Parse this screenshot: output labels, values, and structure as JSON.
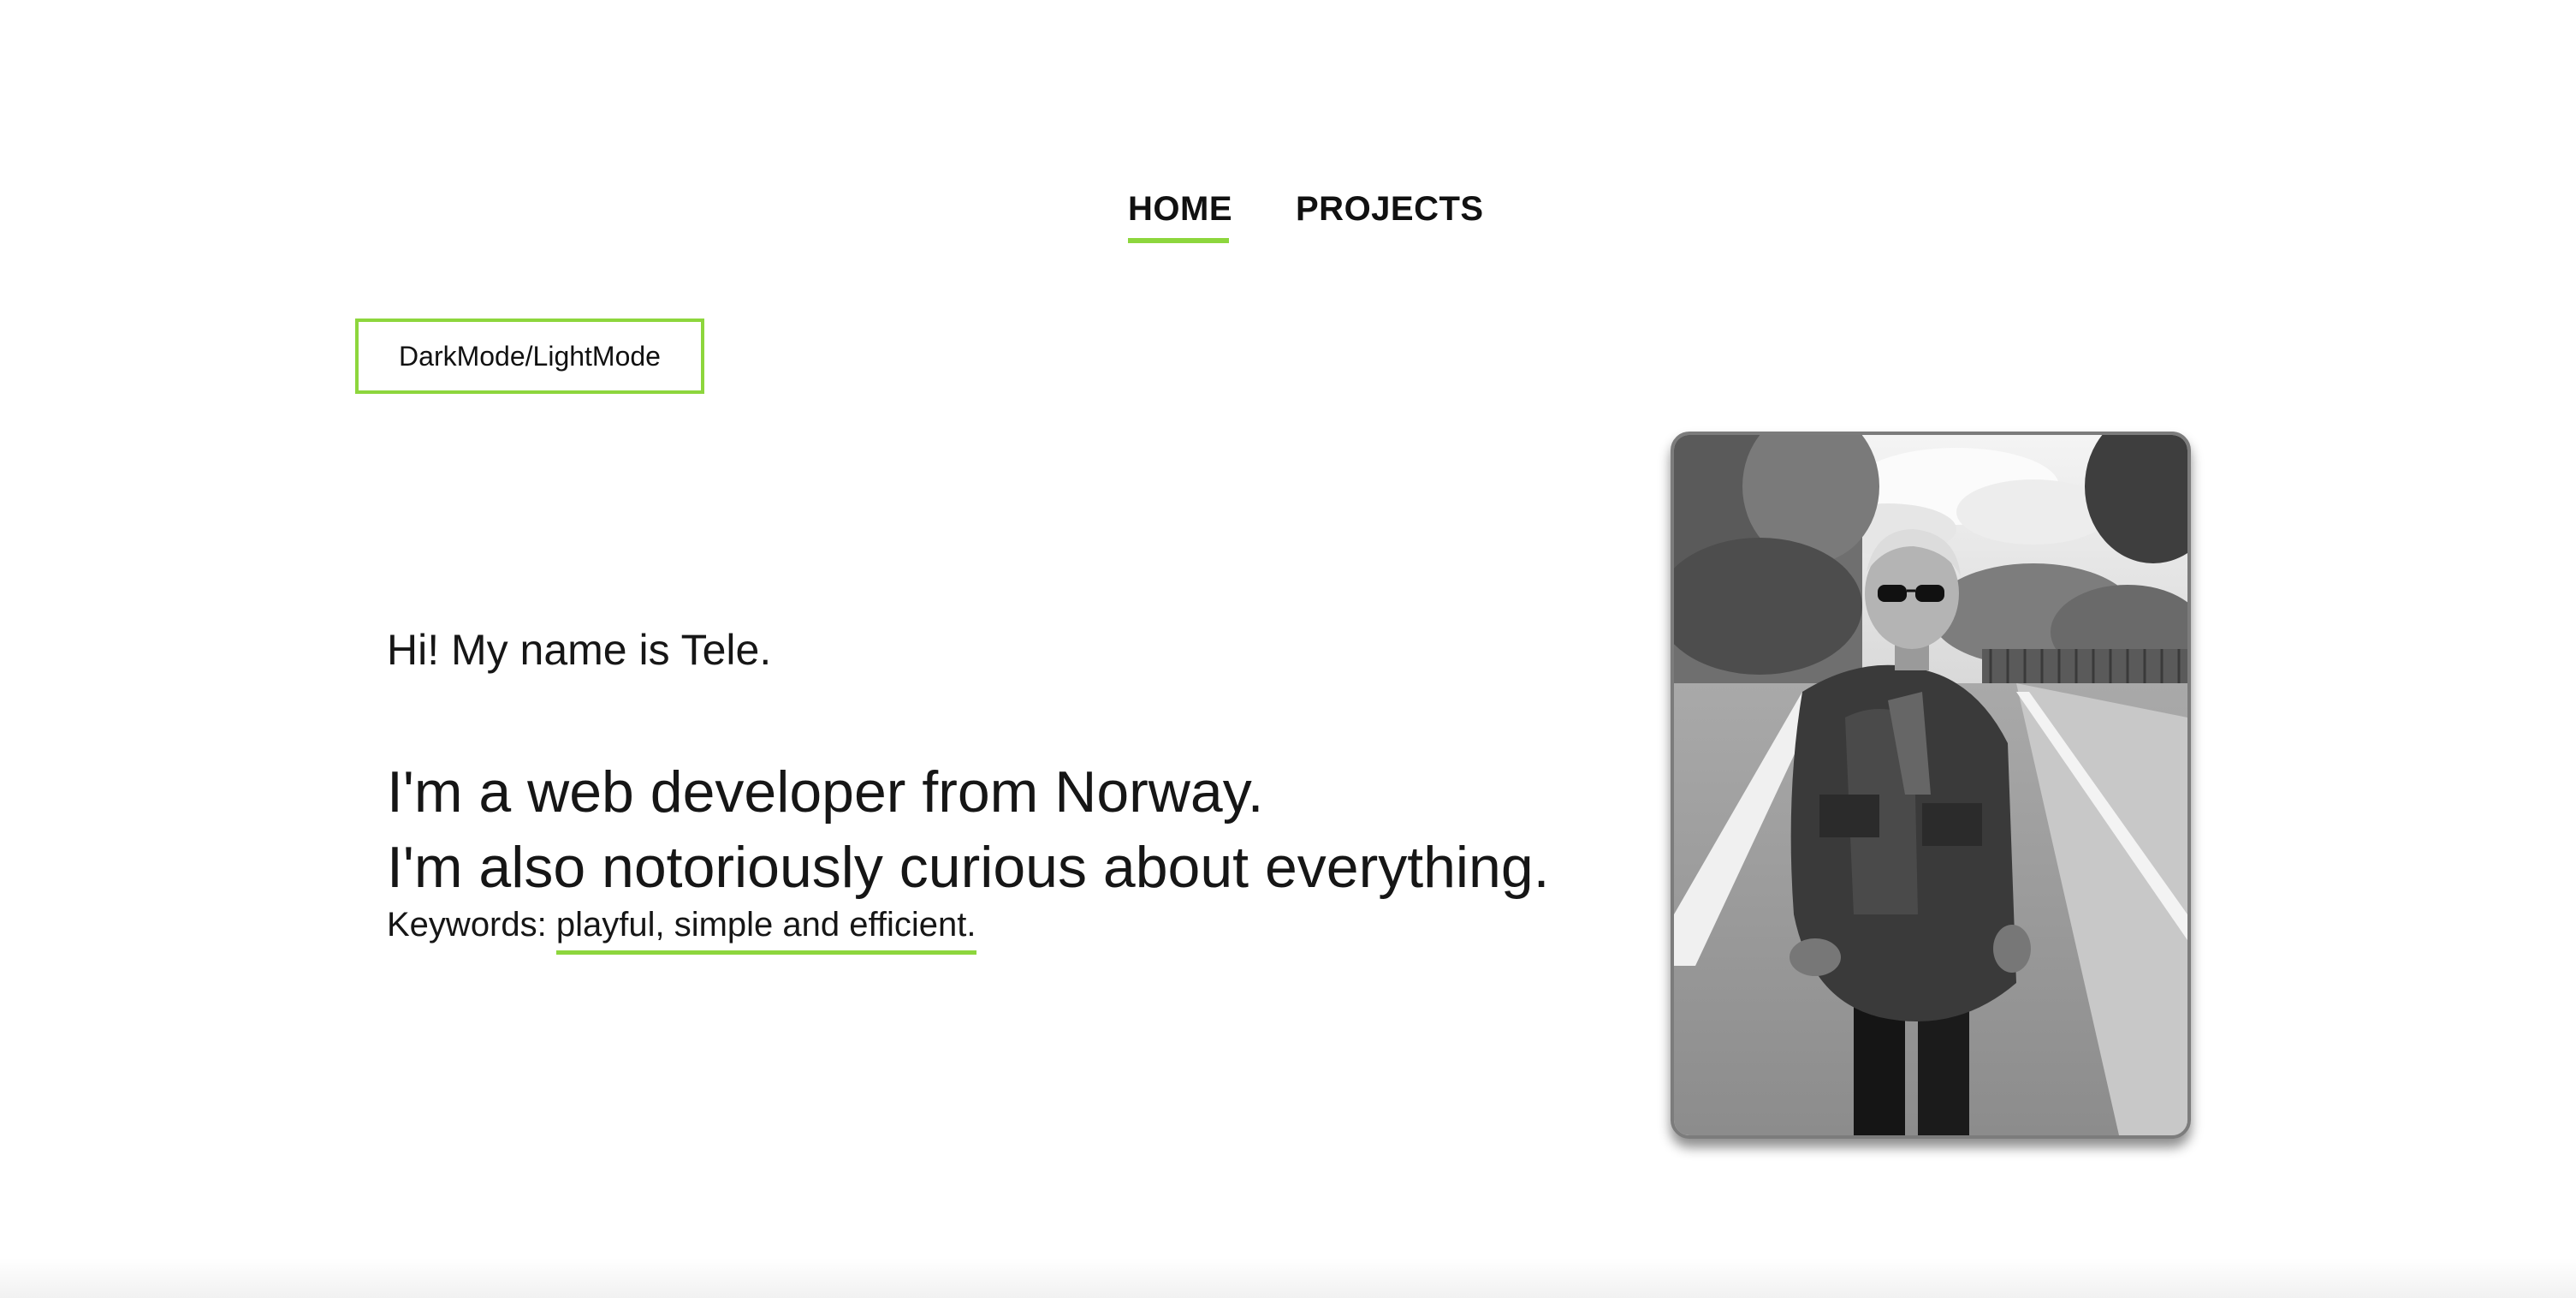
{
  "theme": {
    "accent": "#8dd63d"
  },
  "nav": {
    "items": [
      {
        "label": "HOME",
        "active": true
      },
      {
        "label": "PROJECTS",
        "active": false
      }
    ]
  },
  "toggle": {
    "label": "DarkMode/LightMode"
  },
  "intro": {
    "greeting": "Hi! My name is Tele.",
    "line1": "I'm a web developer from Norway.",
    "line2": "I'm also notoriously curious about everything.",
    "keywords_label": "Keywords: ",
    "keywords_value": "playful, simple and efficient."
  },
  "photo": {
    "icon": "portrait-photo"
  }
}
